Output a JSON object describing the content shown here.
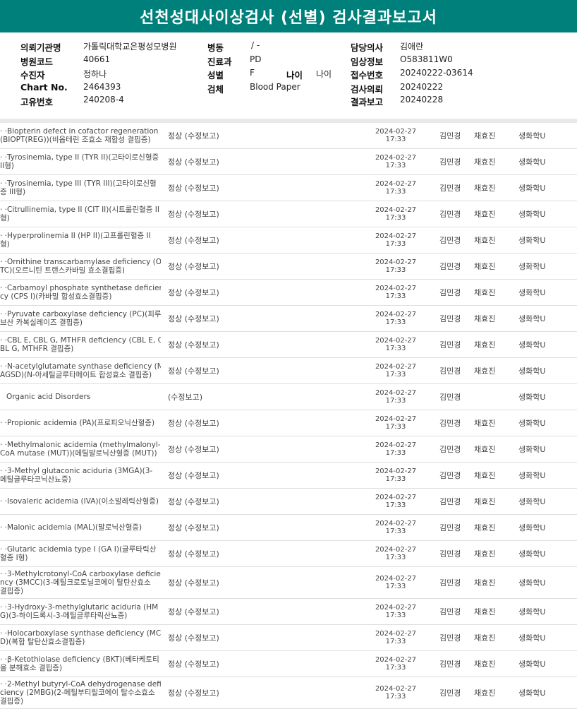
{
  "title": "선천성대사이상검사 (선별) 검사결과보고서",
  "header": {
    "col1": [
      {
        "label": "의뢰기관명",
        "value": "가톨릭대학교은평성모병원"
      },
      {
        "label": "병원코드",
        "value": "40661"
      },
      {
        "label": "수진자",
        "value": "정하나"
      },
      {
        "label": "Chart No.",
        "value": "2464393"
      },
      {
        "label": "고유번호",
        "value": "240208-4"
      }
    ],
    "col2": [
      {
        "label": "병동",
        "value": "/ -"
      },
      {
        "label": "진료과",
        "value": "PD"
      },
      {
        "label": "성별",
        "value": "F"
      },
      {
        "label": "검체",
        "value": "Blood Paper"
      }
    ],
    "age": {
      "label": "나이",
      "value": "나이"
    },
    "col3": [
      {
        "label": "담당의사",
        "value": "김애란"
      },
      {
        "label": "임상정보",
        "value": "O583811W0"
      },
      {
        "label": "접수번호",
        "value": "20240222-03614"
      },
      {
        "label": "검사의뢰",
        "value": "20240222"
      },
      {
        "label": "결과보고",
        "value": "20240228"
      }
    ]
  },
  "rows": [
    {
      "lines": [
        "· ·Biopterin defect in cofactor regeneration",
        "(BIOPT(REG))(비옵테린 조효소 재합성 결핍증)"
      ],
      "result": "정상 (수정보고)",
      "date": "2024-02-27",
      "time": "17:33",
      "p1": "김민경",
      "p2": "채효진",
      "dept": "생화학U"
    },
    {
      "lines": [
        "· ·Tyrosinemia, type II (TYR II)(고타이로신혈증",
        "II형)"
      ],
      "result": "정상 (수정보고)",
      "date": "2024-02-27",
      "time": "17:33",
      "p1": "김민경",
      "p2": "채효진",
      "dept": "생화학U"
    },
    {
      "lines": [
        "· ·Tyrosinemia, type III (TYR III)(고타이로신혈",
        "증 III형)"
      ],
      "result": "정상 (수정보고)",
      "date": "2024-02-27",
      "time": "17:33",
      "p1": "김민경",
      "p2": "채효진",
      "dept": "생화학U"
    },
    {
      "lines": [
        "· ·Citrullinemia, type II (CIT II)(시트룰린혈증 II",
        "형)"
      ],
      "result": "정상 (수정보고)",
      "date": "2024-02-27",
      "time": "17:33",
      "p1": "김민경",
      "p2": "채효진",
      "dept": "생화학U"
    },
    {
      "lines": [
        "· ·Hyperprolinemia II (HP II)(고프롤린혈증 II",
        "형)"
      ],
      "result": "정상 (수정보고)",
      "date": "2024-02-27",
      "time": "17:33",
      "p1": "김민경",
      "p2": "채효진",
      "dept": "생화학U"
    },
    {
      "lines": [
        "· ·Ornithine transcarbamylase deficiency (O",
        "TC)(오르니틴 트랜스카바밀 효소결핍증)"
      ],
      "result": "정상 (수정보고)",
      "date": "2024-02-27",
      "time": "17:33",
      "p1": "김민경",
      "p2": "채효진",
      "dept": "생화학U"
    },
    {
      "lines": [
        "· ·Carbamoyl phosphate synthetase deficien",
        "cy (CPS I)(카바밀 합성효소결핍증)"
      ],
      "result": "정상 (수정보고)",
      "date": "2024-02-27",
      "time": "17:33",
      "p1": "김민경",
      "p2": "채효진",
      "dept": "생화학U"
    },
    {
      "lines": [
        "· ·Pyruvate carboxylase deficiency (PC)(피루",
        "브산 카복실레이즈 결핍증)"
      ],
      "result": "정상 (수정보고)",
      "date": "2024-02-27",
      "time": "17:33",
      "p1": "김민경",
      "p2": "채효진",
      "dept": "생화학U"
    },
    {
      "lines": [
        "· ·CBL E, CBL G, MTHFR deficiency (CBL E, C",
        "BL G, MTHFR 결핍증)"
      ],
      "result": "정상 (수정보고)",
      "date": "2024-02-27",
      "time": "17:33",
      "p1": "김민경",
      "p2": "채효진",
      "dept": "생화학U"
    },
    {
      "lines": [
        "· ·N-acetylglutamate synthase deficiency (N",
        "AGSD)(N-아세틸글루타메이트 합성효소 결핍증)"
      ],
      "result": "정상 (수정보고)",
      "date": "2024-02-27",
      "time": "17:33",
      "p1": "김민경",
      "p2": "채효진",
      "dept": "생화학U"
    },
    {
      "lines": [
        "Organic acid Disorders"
      ],
      "single": true,
      "result": "(수정보고)",
      "date": "2024-02-27",
      "time": "17:33",
      "p1": "김민경",
      "p2": "",
      "dept": "생화학U"
    },
    {
      "lines": [
        "· ·Propionic acidemia (PA)(프로피오닉산혈증)"
      ],
      "result": "정상 (수정보고)",
      "date": "2024-02-27",
      "time": "17:33",
      "p1": "김민경",
      "p2": "채효진",
      "dept": "생화학U"
    },
    {
      "lines": [
        "· ·Methylmalonic acidemia (methylmalonyl-",
        "CoA mutase (MUT))(메틸말로닉산혈증 (MUT))"
      ],
      "result": "정상 (수정보고)",
      "date": "2024-02-27",
      "time": "17:33",
      "p1": "김민경",
      "p2": "채효진",
      "dept": "생화학U"
    },
    {
      "lines": [
        "· ·3-Methyl glutaconic aciduria (3MGA)(3-",
        "메틸글루타코닉산뇨증)"
      ],
      "result": "정상 (수정보고)",
      "date": "2024-02-27",
      "time": "17:33",
      "p1": "김민경",
      "p2": "채효진",
      "dept": "생화학U"
    },
    {
      "lines": [
        "· ·Isovaleric acidemia (IVA)(이소발레릭산혈증)"
      ],
      "result": "정상 (수정보고)",
      "date": "2024-02-27",
      "time": "17:33",
      "p1": "김민경",
      "p2": "채효진",
      "dept": "생화학U"
    },
    {
      "lines": [
        "· ·Malonic acidemia (MAL)(말로닉산혈증)"
      ],
      "result": "정상 (수정보고)",
      "date": "2024-02-27",
      "time": "17:33",
      "p1": "김민경",
      "p2": "채효진",
      "dept": "생화학U"
    },
    {
      "lines": [
        "· ·Glutaric acidemia type I (GA I)(글루타릭산",
        "혈증 I형)"
      ],
      "result": "정상 (수정보고)",
      "date": "2024-02-27",
      "time": "17:33",
      "p1": "김민경",
      "p2": "채효진",
      "dept": "생화학U"
    },
    {
      "lines": [
        "· ·3-Methylcrotonyl-CoA carboxylase deficie",
        "ncy (3MCC)(3-메틸크로토닐코에이 탈탄산효소",
        "결핍증)"
      ],
      "tall": true,
      "result": "정상 (수정보고)",
      "date": "2024-02-27",
      "time": "17:33",
      "p1": "김민경",
      "p2": "채효진",
      "dept": "생화학U"
    },
    {
      "lines": [
        "· ·3-Hydroxy-3-methylglutaric aciduria (HM",
        "G)(3-하이드록시-3-메틸글루타릭산뇨증)"
      ],
      "result": "정상 (수정보고)",
      "date": "2024-02-27",
      "time": "17:33",
      "p1": "김민경",
      "p2": "채효진",
      "dept": "생화학U"
    },
    {
      "lines": [
        "· ·Holocarboxylase synthase deficiency (MC",
        "D)(복합 탈탄산효소결핍증)"
      ],
      "result": "정상 (수정보고)",
      "date": "2024-02-27",
      "time": "17:33",
      "p1": "김민경",
      "p2": "채효진",
      "dept": "생화학U"
    },
    {
      "lines": [
        "· ·β-Ketothiolase deficiency (BKT)(베타케토티",
        "올 분해효소 결핍증)"
      ],
      "result": "정상 (수정보고)",
      "date": "2024-02-27",
      "time": "17:33",
      "p1": "김민경",
      "p2": "채효진",
      "dept": "생화학U"
    },
    {
      "lines": [
        "· ·2-Methyl butyryl-CoA dehydrogenase defi",
        "ciency (2MBG)(2-메틸부티릴코에이 탈수소효소",
        "결핍증)"
      ],
      "tall": true,
      "result": "정상 (수정보고)",
      "date": "2024-02-27",
      "time": "17:33",
      "p1": "김민경",
      "p2": "채효진",
      "dept": "생화학U"
    }
  ]
}
